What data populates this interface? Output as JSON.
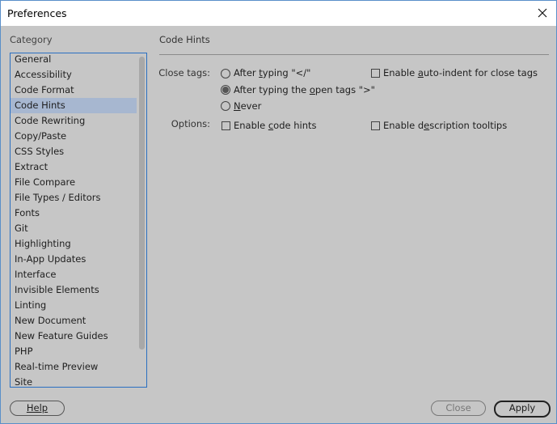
{
  "window": {
    "title": "Preferences"
  },
  "category": {
    "label": "Category",
    "items": [
      "General",
      "Accessibility",
      "Code Format",
      "Code Hints",
      "Code Rewriting",
      "Copy/Paste",
      "CSS Styles",
      "Extract",
      "File Compare",
      "File Types / Editors",
      "Fonts",
      "Git",
      "Highlighting",
      "In-App Updates",
      "Interface",
      "Invisible Elements",
      "Linting",
      "New Document",
      "New Feature Guides",
      "PHP",
      "Real-time Preview",
      "Site"
    ],
    "selected": "Code Hints"
  },
  "panel": {
    "title": "Code Hints",
    "close_tags_label": "Close tags:",
    "radio_1_pre": "After ",
    "radio_1_u": "t",
    "radio_1_post": "yping \"</\"",
    "radio_2_pre": "After typing the ",
    "radio_2_u": "o",
    "radio_2_post": "pen tags \">\"",
    "radio_3_u": "N",
    "radio_3_post": "ever",
    "selected_radio": "After typing the open tags \">\"",
    "auto_indent_pre": "Enable ",
    "auto_indent_u": "a",
    "auto_indent_post": "uto-indent for close tags",
    "options_label": "Options:",
    "code_hints_pre": "Enable ",
    "code_hints_u": "c",
    "code_hints_post": "ode hints",
    "desc_pre": "Enable d",
    "desc_u": "e",
    "desc_post": "scription tooltips"
  },
  "buttons": {
    "help": "Help",
    "close": "Close",
    "apply": "Apply"
  }
}
